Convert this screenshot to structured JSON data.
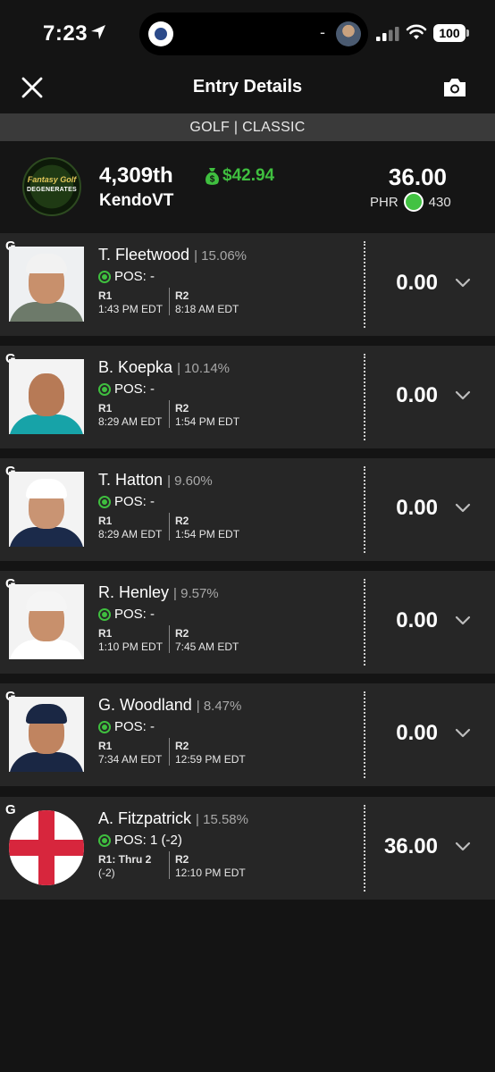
{
  "status_bar": {
    "time": "7:23",
    "battery": "100",
    "island_dash": "-"
  },
  "header": {
    "title": "Entry Details"
  },
  "subheader": "GOLF | CLASSIC",
  "summary": {
    "logo_line1": "Fantasy Golf",
    "logo_line2": "DEGENERATES",
    "rank": "4,309th",
    "prize": "$42.94",
    "username": "KendoVT",
    "points": "36.00",
    "phr_label": "PHR",
    "phr_value": "430"
  },
  "players": [
    {
      "pos": "G",
      "name": "T. Fleetwood",
      "pct": "| 15.06%",
      "status": "POS: -",
      "r1_label": "R1",
      "r1_time": "1:43 PM EDT",
      "r1_extra": "",
      "r2_label": "R2",
      "r2_time": "8:18 AM EDT",
      "score": "0.00"
    },
    {
      "pos": "G",
      "name": "B. Koepka",
      "pct": "| 10.14%",
      "status": "POS: -",
      "r1_label": "R1",
      "r1_time": "8:29 AM EDT",
      "r1_extra": "",
      "r2_label": "R2",
      "r2_time": "1:54 PM EDT",
      "score": "0.00"
    },
    {
      "pos": "G",
      "name": "T. Hatton",
      "pct": "| 9.60%",
      "status": "POS: -",
      "r1_label": "R1",
      "r1_time": "8:29 AM EDT",
      "r1_extra": "",
      "r2_label": "R2",
      "r2_time": "1:54 PM EDT",
      "score": "0.00"
    },
    {
      "pos": "G",
      "name": "R. Henley",
      "pct": "| 9.57%",
      "status": "POS: -",
      "r1_label": "R1",
      "r1_time": "1:10 PM EDT",
      "r1_extra": "",
      "r2_label": "R2",
      "r2_time": "7:45 AM EDT",
      "score": "0.00"
    },
    {
      "pos": "G",
      "name": "G. Woodland",
      "pct": "| 8.47%",
      "status": "POS: -",
      "r1_label": "R1",
      "r1_time": "7:34 AM EDT",
      "r1_extra": "",
      "r2_label": "R2",
      "r2_time": "12:59 PM EDT",
      "score": "0.00"
    },
    {
      "pos": "G",
      "name": "A. Fitzpatrick",
      "pct": "| 15.58%",
      "status": "POS: 1 (-2)",
      "r1_label": "R1: Thru 2",
      "r1_time": "(-2)",
      "r1_extra": "",
      "r2_label": "R2",
      "r2_time": "12:10 PM EDT",
      "score": "36.00"
    }
  ],
  "colors": {
    "accent_green": "#3fbf3f",
    "background": "#141414",
    "row_bg": "#262626",
    "flag_red": "#d7263d"
  },
  "icons": {
    "close": "close-icon",
    "camera": "camera-icon",
    "prize": "money-bag-icon",
    "expand": "chevron-down-icon"
  }
}
